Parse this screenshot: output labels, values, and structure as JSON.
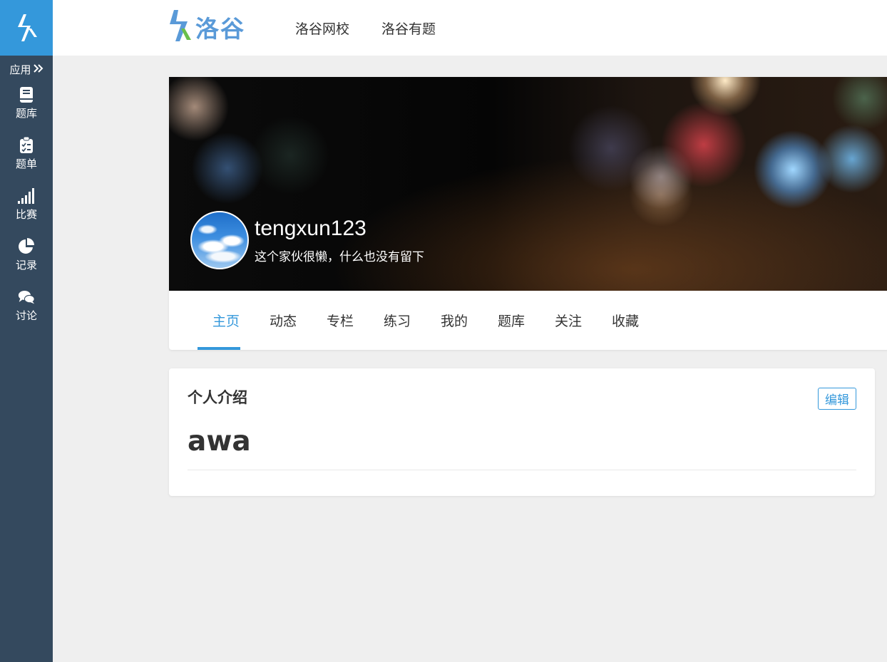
{
  "sidebar": {
    "apps_label": "应用",
    "items": [
      {
        "label": "题库",
        "icon": "book-icon"
      },
      {
        "label": "题单",
        "icon": "clipboard-icon"
      },
      {
        "label": "比赛",
        "icon": "signal-bars-icon"
      },
      {
        "label": "记录",
        "icon": "pie-chart-icon"
      },
      {
        "label": "讨论",
        "icon": "chat-bubbles-icon"
      }
    ]
  },
  "header": {
    "brand": "洛谷",
    "nav": [
      "洛谷网校",
      "洛谷有题"
    ]
  },
  "profile": {
    "username": "tengxun123",
    "slogan": "这个家伙很懒，什么也没有留下",
    "tabs": [
      "主页",
      "动态",
      "专栏",
      "练习",
      "我的",
      "题库",
      "关注",
      "收藏"
    ],
    "active_tab": "主页"
  },
  "intro": {
    "title": "个人介绍",
    "edit_label": "编辑",
    "content": "awa"
  },
  "colors": {
    "accent": "#3498db",
    "sidebar_bg": "#34495e",
    "page_bg": "#efefef"
  }
}
